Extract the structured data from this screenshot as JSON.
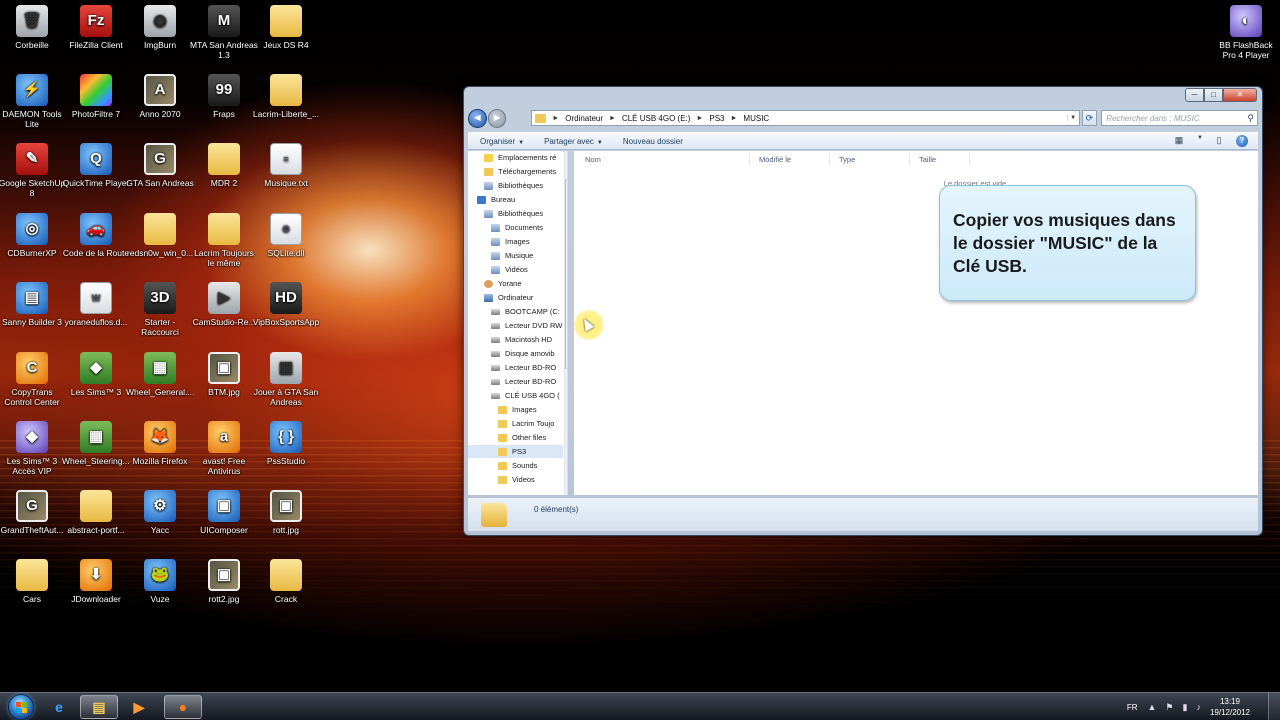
{
  "desktop": {
    "icons": [
      {
        "label": "Corbeille",
        "glyph": "🗑",
        "style": "i-gray"
      },
      {
        "label": "FileZilla Client",
        "glyph": "Fz",
        "style": "i-red"
      },
      {
        "label": "ImgBurn",
        "glyph": "◉",
        "style": "i-gray"
      },
      {
        "label": "MTA San Andreas 1.3",
        "glyph": "M",
        "style": "i-dark"
      },
      {
        "label": "Jeux DS R4",
        "glyph": "",
        "style": "i-folder"
      },
      {
        "label": "DAEMON Tools Lite",
        "glyph": "⚡",
        "style": "i-blue"
      },
      {
        "label": "PhotoFiltre 7",
        "glyph": "",
        "style": "i-rainbow"
      },
      {
        "label": "Anno 2070",
        "glyph": "A",
        "style": "i-image"
      },
      {
        "label": "Fraps",
        "glyph": "99",
        "style": "i-dark"
      },
      {
        "label": "Lacrim-Liberte_...",
        "glyph": "",
        "style": "i-folder"
      },
      {
        "label": "Google SketchUp 8",
        "glyph": "✎",
        "style": "i-red"
      },
      {
        "label": "QuickTime Player",
        "glyph": "Q",
        "style": "i-blue"
      },
      {
        "label": "GTA San Andreas",
        "glyph": "G",
        "style": "i-image"
      },
      {
        "label": "MDR 2",
        "glyph": "",
        "style": "i-folder"
      },
      {
        "label": "Musique.txt",
        "glyph": "≡",
        "style": "i-file"
      },
      {
        "label": "CDBurnerXP",
        "glyph": "◎",
        "style": "i-blue"
      },
      {
        "label": "Code de la Route",
        "glyph": "🚗",
        "style": "i-blue"
      },
      {
        "label": "redsn0w_win_0...",
        "glyph": "",
        "style": "i-folder"
      },
      {
        "label": "Lacrim Toujours le même",
        "glyph": "",
        "style": "i-folder"
      },
      {
        "label": "SQLite.dll",
        "glyph": "⚙",
        "style": "i-file"
      },
      {
        "label": "Sanny Builder 3",
        "glyph": "▤",
        "style": "i-blue"
      },
      {
        "label": "yoraneduflos.d...",
        "glyph": "W",
        "style": "i-file"
      },
      {
        "label": "Starter - Raccourci",
        "glyph": "3D",
        "style": "i-dark"
      },
      {
        "label": "CamStudio-Re...",
        "glyph": "▶",
        "style": "i-gray"
      },
      {
        "label": "VipBoxSportsApp",
        "glyph": "HD",
        "style": "i-dark"
      },
      {
        "label": "CopyTrans Control Center",
        "glyph": "C",
        "style": "i-orange"
      },
      {
        "label": "Les Sims™ 3",
        "glyph": "◆",
        "style": "i-green"
      },
      {
        "label": "Wheel_General....",
        "glyph": "▦",
        "style": "i-green"
      },
      {
        "label": "BTM.jpg",
        "glyph": "▣",
        "style": "i-image"
      },
      {
        "label": "Jouer à GTA San Andreas",
        "glyph": "▦",
        "style": "i-gray"
      },
      {
        "label": "Les Sims™ 3 Accès VIP",
        "glyph": "◆",
        "style": "i-purple"
      },
      {
        "label": "Wheel_Steering....",
        "glyph": "▦",
        "style": "i-green"
      },
      {
        "label": "Mozilla Firefox",
        "glyph": "🦊",
        "style": "i-orange"
      },
      {
        "label": "avast! Free Antivirus",
        "glyph": "a",
        "style": "i-orange"
      },
      {
        "label": "PssStudio",
        "glyph": "{ }",
        "style": "i-blue"
      },
      {
        "label": "GrandTheftAut...",
        "glyph": "G",
        "style": "i-image"
      },
      {
        "label": "abstract-portf...",
        "glyph": "",
        "style": "i-folder"
      },
      {
        "label": "Yacc",
        "glyph": "⚙",
        "style": "i-blue"
      },
      {
        "label": "UIComposer",
        "glyph": "▣",
        "style": "i-blue"
      },
      {
        "label": "rott.jpg",
        "glyph": "▣",
        "style": "i-image"
      },
      {
        "label": "Cars",
        "glyph": "",
        "style": "i-folder"
      },
      {
        "label": "JDownloader",
        "glyph": "⬇",
        "style": "i-orange"
      },
      {
        "label": "Vuze",
        "glyph": "🐸",
        "style": "i-blue"
      },
      {
        "label": "rott2.jpg",
        "glyph": "▣",
        "style": "i-image"
      },
      {
        "label": "Crack",
        "glyph": "",
        "style": "i-folder"
      },
      {
        "label": "BB FlashBack Pro 4 Player",
        "glyph": "◐",
        "style": "i-purple"
      }
    ]
  },
  "explorer": {
    "window_controls": {
      "minimize": "─",
      "maximize": "□",
      "close": "✕"
    },
    "nav": {
      "back": "◄",
      "forward": "►"
    },
    "address": {
      "crumbs": [
        "Ordinateur",
        "CLÉ USB 4GO (E:)",
        "PS3",
        "MUSIC"
      ],
      "dropdown": "▼",
      "refresh": "⟳"
    },
    "search": {
      "placeholder": "Rechercher dans : MUSIC",
      "icon": "search-icon"
    },
    "toolbar": {
      "organize": "Organiser",
      "share": "Partager avec",
      "new_folder": "Nouveau dossier",
      "arrow": "▼",
      "view_icon": "▦",
      "pane_icon": "▯",
      "help": "?"
    },
    "nav_pane": {
      "items": [
        {
          "label": "Emplacements ré",
          "icon": "t-star",
          "indent": 0
        },
        {
          "label": "Téléchargements",
          "icon": "t-folder",
          "indent": 0
        },
        {
          "label": "Bibliothèques",
          "icon": "t-lib",
          "indent": 0
        },
        {
          "label": "Bureau",
          "icon": "t-desk",
          "indent": -7
        },
        {
          "label": "Bibliothèques",
          "icon": "t-lib",
          "indent": 0
        },
        {
          "label": "Documents",
          "icon": "t-lib",
          "indent": 7
        },
        {
          "label": "Images",
          "icon": "t-lib",
          "indent": 7
        },
        {
          "label": "Musique",
          "icon": "t-lib",
          "indent": 7
        },
        {
          "label": "Vidéos",
          "icon": "t-lib",
          "indent": 7
        },
        {
          "label": "Yorane",
          "icon": "t-user",
          "indent": 0
        },
        {
          "label": "Ordinateur",
          "icon": "t-comp",
          "indent": 0
        },
        {
          "label": "BOOTCAMP (C:",
          "icon": "t-drive",
          "indent": 7
        },
        {
          "label": "Lecteur DVD RW",
          "icon": "t-drive",
          "indent": 7
        },
        {
          "label": "Macintosh HD",
          "icon": "t-drive",
          "indent": 7
        },
        {
          "label": "Disque amovib",
          "icon": "t-drive",
          "indent": 7
        },
        {
          "label": "Lecteur BD-RO",
          "icon": "t-drive",
          "indent": 7
        },
        {
          "label": "Lecteur BD-RO",
          "icon": "t-drive",
          "indent": 7
        },
        {
          "label": "CLÉ USB 4GO (",
          "icon": "t-drive",
          "indent": 7
        },
        {
          "label": "Images",
          "icon": "t-folder",
          "indent": 14
        },
        {
          "label": "Lacrim Toujo",
          "icon": "t-folder",
          "indent": 14
        },
        {
          "label": "Other files",
          "icon": "t-folder",
          "indent": 14
        },
        {
          "label": "PS3",
          "icon": "t-folder",
          "indent": 14,
          "selected": true
        },
        {
          "label": "Sounds",
          "icon": "t-folder",
          "indent": 14
        },
        {
          "label": "Videos",
          "icon": "t-folder",
          "indent": 14
        }
      ]
    },
    "columns": [
      "Nom",
      "Modifié le",
      "Type",
      "Taille"
    ],
    "empty_message": "Le dossier est vide.",
    "status": {
      "count": "0 élément(s)"
    }
  },
  "callout": {
    "text": "Copier vos musiques dans le dossier \"MUSIC\" de la Clé USB."
  },
  "taskbar": {
    "apps": [
      {
        "name": "taskbar-ie",
        "glyph": "e",
        "color": "#3aa0ff"
      },
      {
        "name": "taskbar-explorer",
        "glyph": "▤",
        "color": "#f0c959",
        "active": true
      },
      {
        "name": "taskbar-media-player",
        "glyph": "▶",
        "color": "#ff9a2e"
      },
      {
        "name": "taskbar-firefox",
        "glyph": "●",
        "color": "#ff7a1a",
        "active": true
      }
    ],
    "language": "FR",
    "tray_icons": [
      "▲",
      "⚑",
      "▮",
      "♪"
    ],
    "time": "13:19",
    "date": "19/12/2012"
  },
  "colors": {
    "accent": "#3a78c9",
    "callout_bg": "#d6eefb",
    "folder": "#f0c959"
  }
}
